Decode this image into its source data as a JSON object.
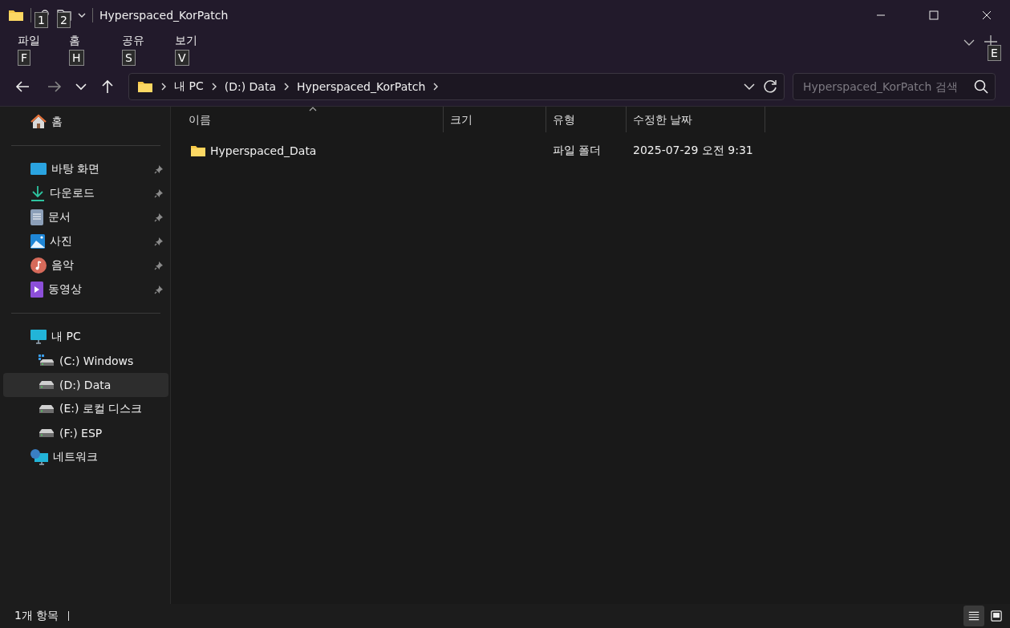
{
  "window": {
    "title": "Hyperspaced_KorPatch"
  },
  "quick_access_keytips": [
    "1",
    "2"
  ],
  "menu": [
    {
      "label": "파일",
      "keytip": "F"
    },
    {
      "label": "홈",
      "keytip": "H"
    },
    {
      "label": "공유",
      "keytip": "S"
    },
    {
      "label": "보기",
      "keytip": "V"
    }
  ],
  "ribbon_keytip": "E",
  "breadcrumb": [
    "내 PC",
    "(D:) Data",
    "Hyperspaced_KorPatch"
  ],
  "search": {
    "placeholder": "Hyperspaced_KorPatch 검색"
  },
  "sidebar": {
    "sections": [
      {
        "items": [
          {
            "kind": "home",
            "label": "홈",
            "pinned": false,
            "selected": false
          }
        ]
      },
      {
        "items": [
          {
            "kind": "desktop",
            "label": "바탕 화면",
            "pinned": true,
            "selected": false
          },
          {
            "kind": "download",
            "label": "다운로드",
            "pinned": true,
            "selected": false
          },
          {
            "kind": "documents",
            "label": "문서",
            "pinned": true,
            "selected": false
          },
          {
            "kind": "pictures",
            "label": "사진",
            "pinned": true,
            "selected": false
          },
          {
            "kind": "music",
            "label": "음악",
            "pinned": true,
            "selected": false
          },
          {
            "kind": "videos",
            "label": "동영상",
            "pinned": true,
            "selected": false
          }
        ]
      },
      {
        "items": [
          {
            "kind": "pc",
            "label": "내 PC",
            "pinned": false,
            "selected": false,
            "children": [
              {
                "kind": "system-drive",
                "label": "(C:) Windows",
                "pinned": false,
                "selected": false
              },
              {
                "kind": "drive",
                "label": "(D:) Data",
                "pinned": false,
                "selected": true
              },
              {
                "kind": "drive",
                "label": "(E:) 로컬 디스크",
                "pinned": false,
                "selected": false
              },
              {
                "kind": "drive",
                "label": "(F:) ESP",
                "pinned": false,
                "selected": false
              }
            ]
          },
          {
            "kind": "network",
            "label": "네트워크",
            "pinned": false,
            "selected": false
          }
        ]
      }
    ]
  },
  "table": {
    "columns": [
      {
        "label": "이름",
        "sorted": true
      },
      {
        "label": "크기",
        "sorted": false
      },
      {
        "label": "유형",
        "sorted": false
      },
      {
        "label": "수정한 날짜",
        "sorted": false
      }
    ],
    "rows": [
      {
        "name": "Hyperspaced_Data",
        "type": "파일 폴더",
        "modified": "2025-07-29 오전 9:31"
      }
    ]
  },
  "status_bar": {
    "count": "1개 항목"
  },
  "view_buttons": [
    {
      "kind": "details",
      "selected": true
    },
    {
      "kind": "tiles",
      "selected": false
    }
  ]
}
